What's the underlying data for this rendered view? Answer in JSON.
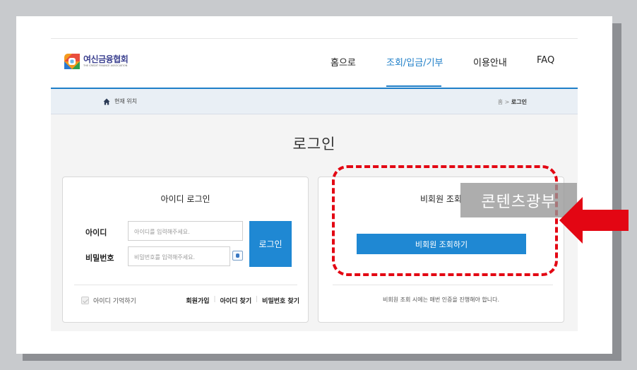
{
  "header": {
    "logo": {
      "name": "여신금융협회",
      "sub": "THE CREDIT FINANCE ASSOCIATION"
    },
    "nav": [
      {
        "label": "홈으로"
      },
      {
        "label": "조회/입금/기부"
      },
      {
        "label": "이용안내"
      },
      {
        "label": "FAQ"
      }
    ]
  },
  "breadcrumb": {
    "location_label": "현재 위치",
    "home": "홈",
    "separator": ">",
    "current": "로그인"
  },
  "page": {
    "title": "로그인"
  },
  "id_login": {
    "title": "아이디 로그인",
    "id_label": "아이디",
    "id_placeholder": "아이디를 입력해주세요.",
    "pw_label": "비밀번호",
    "pw_placeholder": "비밀번호를 입력해주세요.",
    "login_button": "로그인",
    "remember_label": "아이디 기억하기",
    "links": {
      "join": "회원가입",
      "find_id": "아이디 찾기",
      "find_pw": "비밀번호 찾기",
      "sep": "|"
    }
  },
  "guest": {
    "title": "비회원 조회",
    "button": "비회원 조회하기",
    "note": "비회원 조회 시에는 매번 인증을 진행해야 합니다."
  },
  "overlay": {
    "watermark": "콘텐츠광부",
    "highlight_color": "#e30613",
    "arrow_color": "#e30613"
  },
  "colors": {
    "accent": "#1f88d3",
    "nav_active": "#1f7fc8"
  },
  "icons": [
    "home-icon",
    "keyboard-icon",
    "checkbox-icon",
    "logo-icon",
    "arrow-left-icon"
  ]
}
